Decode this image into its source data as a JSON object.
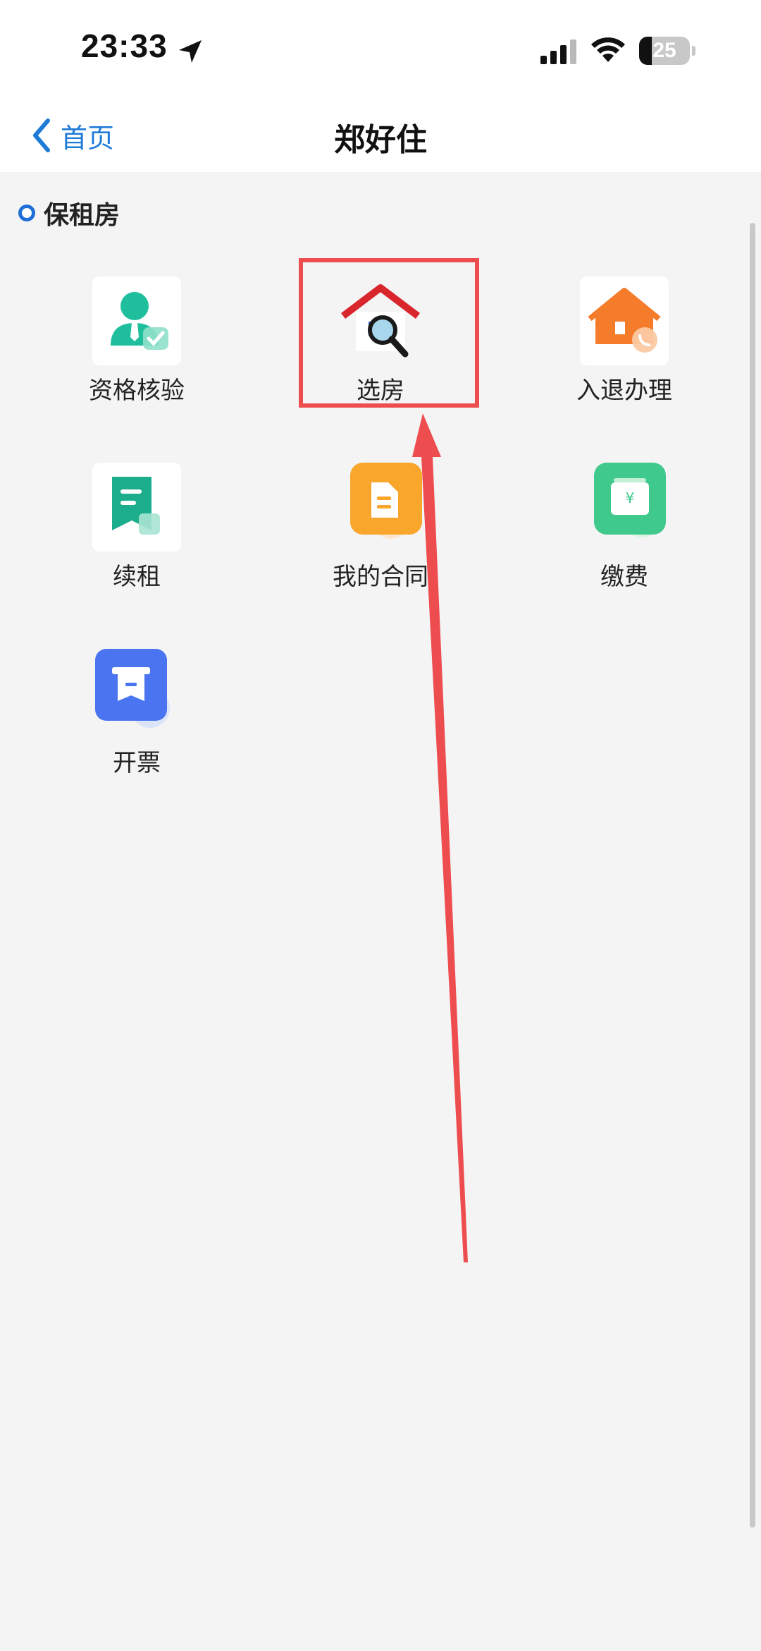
{
  "status_bar": {
    "time": "23:33",
    "battery": "25",
    "battery_level": 0.25
  },
  "nav": {
    "back_label": "首页",
    "title": "郑好住"
  },
  "section": {
    "title": "保租房"
  },
  "tiles": [
    {
      "label": "资格核验",
      "icon": "qualification-check-icon"
    },
    {
      "label": "选房",
      "icon": "house-search-icon"
    },
    {
      "label": "入退办理",
      "icon": "check-in-out-house-icon"
    },
    {
      "label": "续租",
      "icon": "lease-renewal-icon"
    },
    {
      "label": "我的合同",
      "icon": "contract-document-icon"
    },
    {
      "label": "缴费",
      "icon": "payment-wallet-icon"
    },
    {
      "label": "开票",
      "icon": "invoice-printer-icon"
    }
  ],
  "colors": {
    "accent": "#1f7bd8",
    "highlight": "#ee4d4f",
    "teal": "#1fbf9d",
    "orange": "#f47c2b",
    "green": "#3fc98c",
    "blue": "#4a74f0"
  }
}
